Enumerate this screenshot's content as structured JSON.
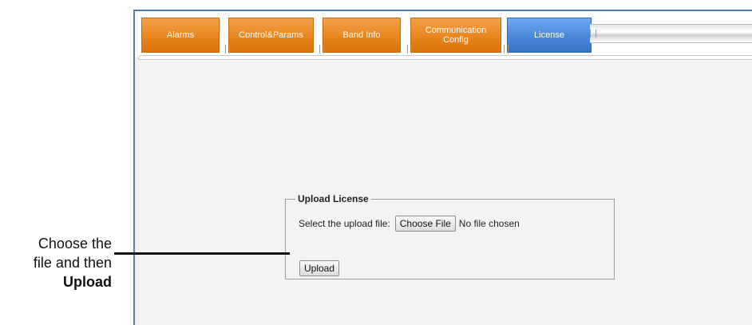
{
  "tabs": [
    {
      "label": "Alarms",
      "active": false
    },
    {
      "label": "Control&Params",
      "active": false
    },
    {
      "label": "Band Info",
      "active": false
    },
    {
      "label": "Communication Config",
      "active": false
    },
    {
      "label": "License",
      "active": true
    }
  ],
  "upload_panel": {
    "legend": "Upload License",
    "select_label": "Select the upload file:",
    "choose_button": "Choose File",
    "file_status": "No file chosen",
    "upload_button": "Upload"
  },
  "callout": {
    "line1": "Choose the",
    "line2": "file and then",
    "line3": "Upload"
  },
  "colors": {
    "tab_inactive": "#e8861e",
    "tab_active": "#4a88db",
    "frame_border": "#4f7fb6"
  }
}
